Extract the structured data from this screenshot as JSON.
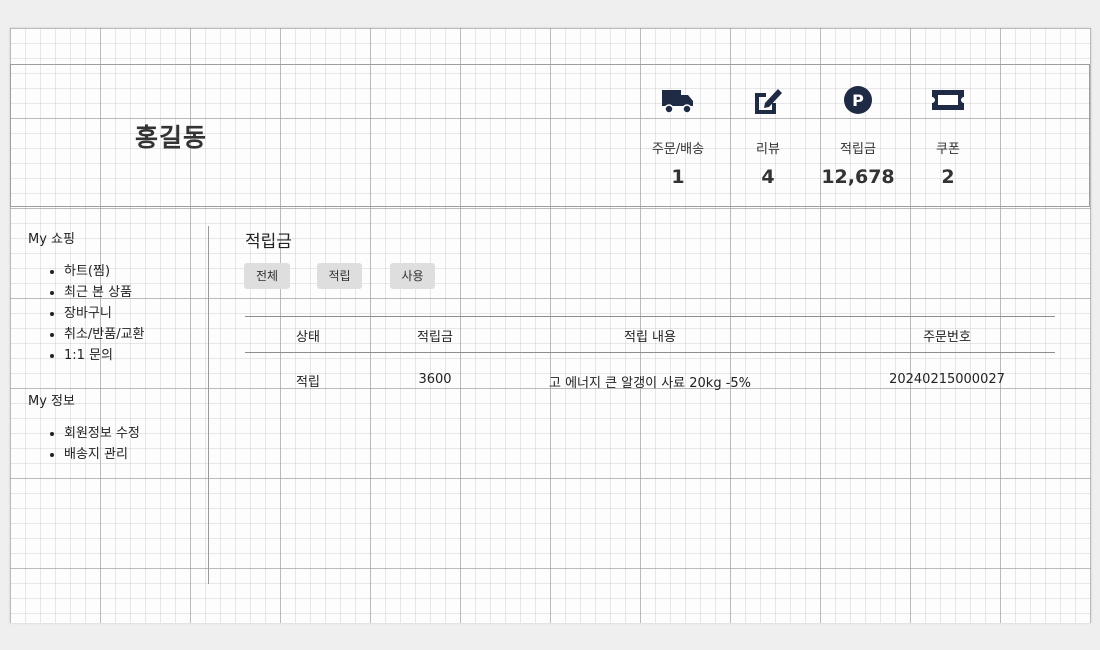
{
  "header": {
    "user_name": "홍길동",
    "stats": [
      {
        "icon": "truck-icon",
        "label": "주문/배송",
        "value": "1"
      },
      {
        "icon": "pencil-square-icon",
        "label": "리뷰",
        "value": "4"
      },
      {
        "icon": "points-icon",
        "label": "적립금",
        "value": "12,678"
      },
      {
        "icon": "ticket-icon",
        "label": "쿠폰",
        "value": "2"
      }
    ]
  },
  "sidebar": {
    "shopping_title": "My 쇼핑",
    "shopping_items": [
      "하트(찜)",
      "최근 본 상품",
      "장바구니",
      "취소/반품/교환",
      "1:1 문의"
    ],
    "info_title": "My 정보",
    "info_items": [
      "회원정보 수정",
      "배송지 관리"
    ]
  },
  "main": {
    "title": "적립금",
    "tabs": [
      "전체",
      "적립",
      "사용"
    ],
    "columns": [
      "상태",
      "적립금",
      "적립 내용",
      "주문번호"
    ],
    "rows": [
      [
        "적립",
        "3600",
        "고 에너지 큰 알갱이 사료 20kg -5%",
        "20240215000027"
      ]
    ]
  },
  "colors": {
    "icon": "#1f2a44",
    "tab_bg": "#dedede"
  }
}
